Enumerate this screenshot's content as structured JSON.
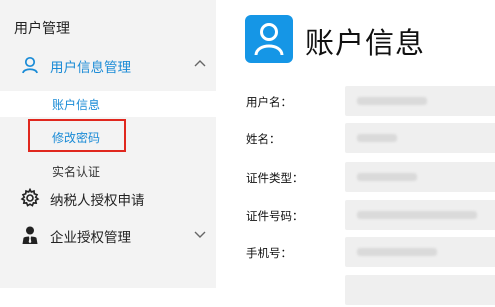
{
  "sidebar": {
    "header": "用户管理",
    "groups": [
      {
        "label": "用户信息管理",
        "expanded": true
      },
      {
        "label": "纳税人授权申请"
      },
      {
        "label": "企业授权管理",
        "expanded": false
      }
    ],
    "items": [
      {
        "label": "账户信息",
        "active": true
      },
      {
        "label": "修改密码",
        "highlighted": true
      },
      {
        "label": "实名认证"
      }
    ]
  },
  "main": {
    "title": "账户信息",
    "fields": [
      {
        "label": "用户名："
      },
      {
        "label": "姓名："
      },
      {
        "label": "证件类型："
      },
      {
        "label": "证件号码："
      },
      {
        "label": "手机号："
      }
    ]
  },
  "colors": {
    "accent": "#1a8bd6",
    "title_icon_bg": "#1596e6",
    "highlight_border": "#e0271e",
    "sidebar_bg": "#f3f3f3"
  },
  "icons": [
    "user-icon",
    "chevron-up-icon",
    "gear-icon",
    "enterprise-user-icon",
    "chevron-down-icon",
    "account-user-icon"
  ]
}
